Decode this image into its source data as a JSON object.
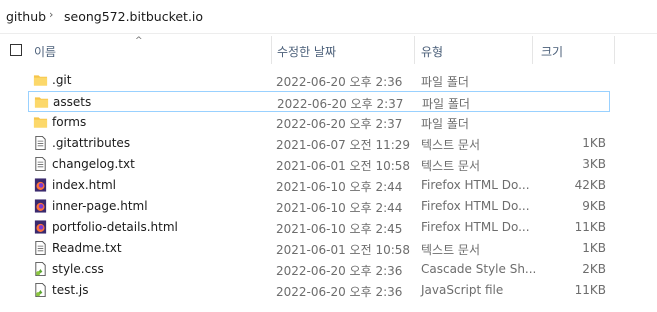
{
  "breadcrumb": {
    "items": [
      "github",
      "seong572.bitbucket.io"
    ],
    "separator": "›"
  },
  "header": {
    "name": "이름",
    "date": "수정한 날짜",
    "type": "유형",
    "size": "크기",
    "sort_indicator": "^"
  },
  "files": [
    {
      "name": ".git",
      "date": "2022-06-20 오후 2:36",
      "type": "파일 폴더",
      "size": "",
      "icon": "folder-icon"
    },
    {
      "name": "assets",
      "date": "2022-06-20 오후 2:37",
      "type": "파일 폴더",
      "size": "",
      "icon": "folder-icon"
    },
    {
      "name": "forms",
      "date": "2022-06-20 오후 2:37",
      "type": "파일 폴더",
      "size": "",
      "icon": "folder-icon"
    },
    {
      "name": ".gitattributes",
      "date": "2021-06-07 오전 11:29",
      "type": "텍스트 문서",
      "size": "1KB",
      "icon": "text-file-icon"
    },
    {
      "name": "changelog.txt",
      "date": "2021-06-01 오전 10:58",
      "type": "텍스트 문서",
      "size": "3KB",
      "icon": "text-file-icon"
    },
    {
      "name": "index.html",
      "date": "2021-06-10 오후 2:44",
      "type": "Firefox HTML Do...",
      "size": "42KB",
      "icon": "firefox-html-icon"
    },
    {
      "name": "inner-page.html",
      "date": "2021-06-10 오후 2:44",
      "type": "Firefox HTML Do...",
      "size": "9KB",
      "icon": "firefox-html-icon"
    },
    {
      "name": "portfolio-details.html",
      "date": "2021-06-10 오후 2:45",
      "type": "Firefox HTML Do...",
      "size": "11KB",
      "icon": "firefox-html-icon"
    },
    {
      "name": "Readme.txt",
      "date": "2021-06-01 오전 10:58",
      "type": "텍스트 문서",
      "size": "1KB",
      "icon": "text-file-icon"
    },
    {
      "name": "style.css",
      "date": "2022-06-20 오후 2:36",
      "type": "Cascade Style Sh...",
      "size": "2KB",
      "icon": "css-file-icon"
    },
    {
      "name": "test.js",
      "date": "2022-06-20 오후 2:36",
      "type": "JavaScript file",
      "size": "11KB",
      "icon": "js-file-icon"
    }
  ],
  "focused_row": "assets",
  "colors": {
    "folder": "#f6c54b",
    "focus_border": "#99d1ff",
    "header_text": "#4c607a",
    "meta_text": "#6d6d6d"
  }
}
